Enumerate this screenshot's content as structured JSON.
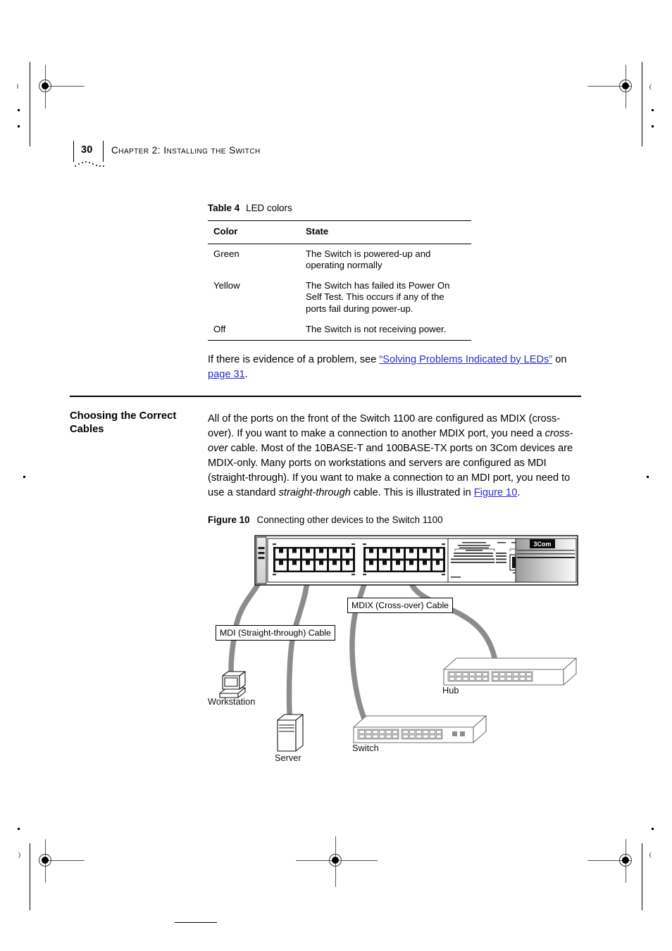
{
  "page": {
    "number": "30",
    "chapter_title": "Chapter 2: Installing the Switch"
  },
  "table": {
    "label": "Table 4",
    "caption": "LED colors",
    "columns": [
      "Color",
      "State"
    ],
    "rows": [
      {
        "color": "Green",
        "state": "The Switch is powered-up and operating normally"
      },
      {
        "color": "Yellow",
        "state": "The Switch has failed its Power On Self Test. This occurs if any of the ports fail during power-up."
      },
      {
        "color": "Off",
        "state": "The Switch is not receiving power."
      }
    ]
  },
  "problem_paragraph": {
    "lead": "If there is evidence of a problem, see ",
    "link_1": "“Solving Problems Indicated by LEDs”",
    "middle": " on ",
    "link_2": "page 31",
    "tail": "."
  },
  "section": {
    "heading": "Choosing the Correct Cables",
    "body_part_1": "All of the ports on the front of the Switch 1100 are configured as MDIX (cross-over). If you want to make a connection to another MDIX port, you need a ",
    "italic_1": "cross-over",
    "body_part_2": " cable. Most of the 10BASE-T and 100BASE-TX ports on 3Com devices are MDIX-only. Many ports on workstations and servers are configured as MDI (straight-through). If you want to make a connection to an MDI port, you need to use a standard ",
    "italic_2": "straight-through",
    "body_part_3": " cable. This is illustrated in ",
    "link_figure": "Figure 10",
    "body_part_4": "."
  },
  "figure": {
    "label": "Figure 10",
    "caption": "Connecting other devices to the Switch 1100",
    "switch_brand": "3Com",
    "cable_labels": {
      "mdi": "MDI (Straight-through) Cable",
      "mdix": "MDIX (Cross-over) Cable"
    },
    "devices": {
      "workstation": "Workstation",
      "server": "Server",
      "switch": "Switch",
      "hub": "Hub"
    }
  },
  "colors": {
    "link": "#2b2bd0",
    "cable": "#8c8c8c",
    "panel_dark": "#1a1a1a",
    "panel_light": "#d8d8d8"
  }
}
